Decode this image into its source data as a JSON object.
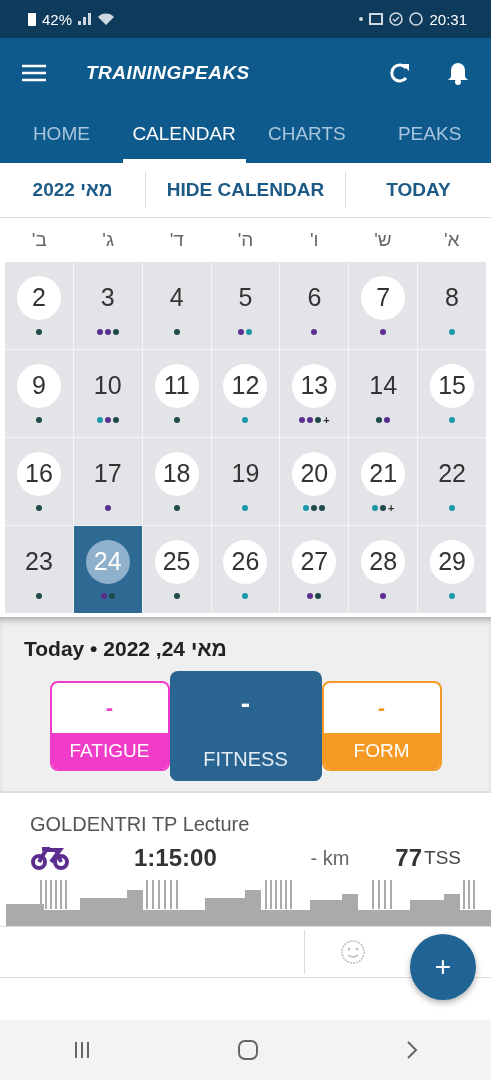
{
  "status_bar": {
    "battery": "42%",
    "time": "20:31"
  },
  "app_bar": {
    "title": "TRAININGPEAKS"
  },
  "tabs": [
    {
      "label": "HOME",
      "selected": false
    },
    {
      "label": "CALENDAR",
      "selected": true
    },
    {
      "label": "CHARTS",
      "selected": false
    },
    {
      "label": "PEAKS",
      "selected": false
    }
  ],
  "toolbar": {
    "month": "2022 מאי",
    "hide": "HIDE CALENDAR",
    "today": "TODAY"
  },
  "weekdays": [
    "א'",
    "ש'",
    "ו'",
    "ה'",
    "ד'",
    "ג'",
    "ב'"
  ],
  "days": [
    {
      "day": "2",
      "circled": true,
      "selected": false,
      "dots": [
        {
          "color": "#1e4a4a"
        }
      ]
    },
    {
      "day": "3",
      "circled": false,
      "selected": false,
      "dots": [
        {
          "color": "#5b2d8e"
        },
        {
          "color": "#5b2d8e"
        },
        {
          "color": "#1e4a4a"
        }
      ]
    },
    {
      "day": "4",
      "circled": false,
      "selected": false,
      "dots": [
        {
          "color": "#1e4a4a"
        }
      ]
    },
    {
      "day": "5",
      "circled": false,
      "selected": false,
      "dots": [
        {
          "color": "#5b2d8e"
        },
        {
          "color": "#1a97aa"
        }
      ]
    },
    {
      "day": "6",
      "circled": false,
      "selected": false,
      "dots": [
        {
          "color": "#5b2d8e"
        }
      ]
    },
    {
      "day": "7",
      "circled": true,
      "selected": false,
      "dots": [
        {
          "color": "#5b2d8e"
        }
      ]
    },
    {
      "day": "8",
      "circled": false,
      "selected": false,
      "dots": [
        {
          "color": "#1a97aa"
        }
      ]
    },
    {
      "day": "9",
      "circled": true,
      "selected": false,
      "dots": [
        {
          "color": "#1e4a4a"
        }
      ]
    },
    {
      "day": "10",
      "circled": false,
      "selected": false,
      "dots": [
        {
          "color": "#1a97aa"
        },
        {
          "color": "#5b2d8e"
        },
        {
          "color": "#1e4a4a"
        }
      ]
    },
    {
      "day": "11",
      "circled": true,
      "selected": false,
      "dots": [
        {
          "color": "#1e4a4a"
        }
      ]
    },
    {
      "day": "12",
      "circled": true,
      "selected": false,
      "dots": [
        {
          "color": "#1a97aa"
        }
      ]
    },
    {
      "day": "13",
      "circled": true,
      "selected": false,
      "dots": [
        {
          "color": "#5b2d8e"
        },
        {
          "color": "#5b2d8e"
        },
        {
          "color": "#1e4a4a"
        }
      ],
      "more": "+"
    },
    {
      "day": "14",
      "circled": false,
      "selected": false,
      "dots": [
        {
          "color": "#1e4a4a"
        },
        {
          "color": "#5b2d8e"
        }
      ]
    },
    {
      "day": "15",
      "circled": true,
      "selected": false,
      "dots": [
        {
          "color": "#1a97aa"
        }
      ]
    },
    {
      "day": "16",
      "circled": true,
      "selected": false,
      "dots": [
        {
          "color": "#1e4a4a"
        }
      ]
    },
    {
      "day": "17",
      "circled": false,
      "selected": false,
      "dots": [
        {
          "color": "#5b2d8e"
        }
      ]
    },
    {
      "day": "18",
      "circled": true,
      "selected": false,
      "dots": [
        {
          "color": "#1e4a4a"
        }
      ]
    },
    {
      "day": "19",
      "circled": false,
      "selected": false,
      "dots": [
        {
          "color": "#1a97aa"
        }
      ]
    },
    {
      "day": "20",
      "circled": true,
      "selected": false,
      "dots": [
        {
          "color": "#1a97aa"
        },
        {
          "color": "#1e4a4a"
        },
        {
          "color": "#1e4a4a"
        }
      ]
    },
    {
      "day": "21",
      "circled": true,
      "selected": false,
      "dots": [
        {
          "color": "#1a97aa"
        },
        {
          "color": "#1e4a4a"
        }
      ],
      "more": "+"
    },
    {
      "day": "22",
      "circled": false,
      "selected": false,
      "dots": [
        {
          "color": "#1a97aa"
        }
      ]
    },
    {
      "day": "23",
      "circled": false,
      "selected": false,
      "dots": [
        {
          "color": "#1e4a4a"
        }
      ]
    },
    {
      "day": "24",
      "circled": true,
      "selected": true,
      "dots": [
        {
          "color": "#5b2d8e"
        },
        {
          "color": "#1e4a4a"
        }
      ]
    },
    {
      "day": "25",
      "circled": true,
      "selected": false,
      "dots": [
        {
          "color": "#1e4a4a"
        }
      ]
    },
    {
      "day": "26",
      "circled": true,
      "selected": false,
      "dots": [
        {
          "color": "#1a97aa"
        }
      ]
    },
    {
      "day": "27",
      "circled": true,
      "selected": false,
      "dots": [
        {
          "color": "#5b2d8e"
        },
        {
          "color": "#1e4a4a"
        }
      ]
    },
    {
      "day": "28",
      "circled": true,
      "selected": false,
      "dots": [
        {
          "color": "#5b2d8e"
        }
      ]
    },
    {
      "day": "29",
      "circled": true,
      "selected": false,
      "dots": [
        {
          "color": "#1a97aa"
        }
      ]
    }
  ],
  "summary": {
    "date": "Today • 2022 ,24 מאי",
    "metrics": [
      {
        "kind": "fatigue",
        "label": "FATIGUE",
        "value": "-",
        "selected": false
      },
      {
        "kind": "fitness",
        "label": "FITNESS",
        "value": "-",
        "selected": true
      },
      {
        "kind": "form",
        "label": "FORM",
        "value": "-",
        "selected": false
      }
    ]
  },
  "workout": {
    "title": "GOLDENTRI TP Lecture",
    "duration": "1:15:00",
    "distance": "- km",
    "tss": "77",
    "tss_unit": "TSS"
  },
  "fab": {
    "label": "+"
  }
}
